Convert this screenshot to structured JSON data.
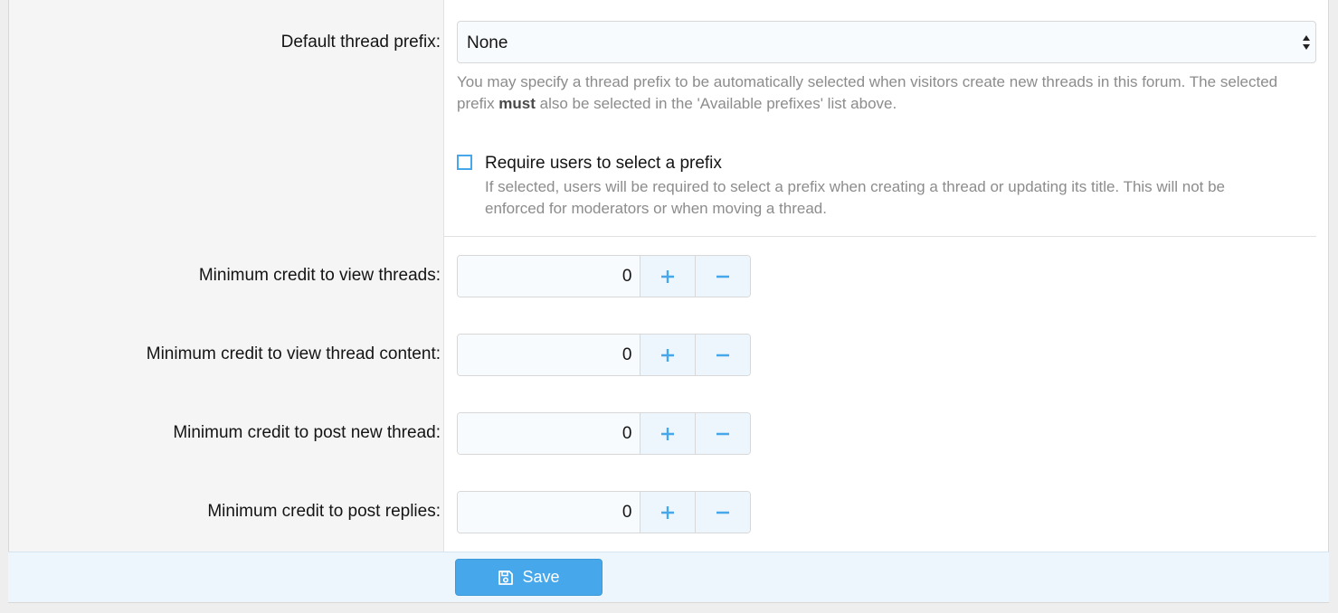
{
  "prefix": {
    "label": "Default thread prefix:",
    "selected": "None",
    "hint_line1": "You may specify a thread prefix to be automatically selected when visitors create new threads in this forum. The selected",
    "hint_line2_start": "prefix ",
    "hint_line2_bold": "must",
    "hint_line2_end": " also be selected in the 'Available prefixes' list above."
  },
  "require_prefix": {
    "label": "Require users to select a prefix",
    "checked": false,
    "hint_line1": "If selected, users will be required to select a prefix when creating a thread or updating its title. This will not be",
    "hint_line2": "enforced for moderators or when moving a thread."
  },
  "credits": [
    {
      "label": "Minimum credit to view threads:",
      "value": "0"
    },
    {
      "label": "Minimum credit to view thread content:",
      "value": "0"
    },
    {
      "label": "Minimum credit to post new thread:",
      "value": "0"
    },
    {
      "label": "Minimum credit to post replies:",
      "value": "0"
    }
  ],
  "icons": {
    "increment": "plus-icon",
    "decrement": "minus-icon",
    "save": "floppy-disk-icon",
    "select": "sort-arrows-icon"
  },
  "colors": {
    "accent": "#47a7eb",
    "button_bg": "#edf6fd"
  },
  "footer": {
    "save_label": "Save"
  }
}
